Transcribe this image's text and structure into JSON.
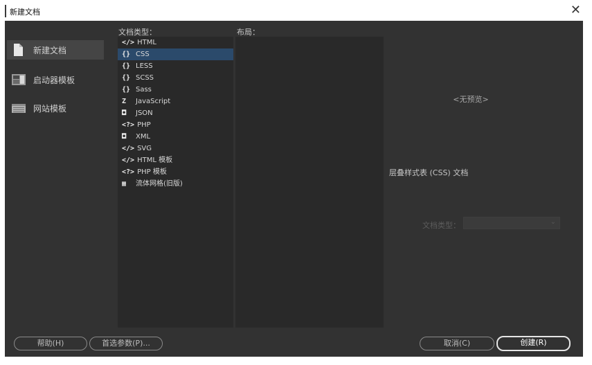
{
  "window": {
    "title": "新建文档",
    "close_glyph": "✕"
  },
  "categories": [
    {
      "label": "新建文档",
      "icon": "new-document-icon"
    },
    {
      "label": "启动器模板",
      "icon": "starter-templates-icon"
    },
    {
      "label": "网站模板",
      "icon": "site-templates-icon"
    }
  ],
  "headers": {
    "doc_type": "文档类型：",
    "layout": "布局："
  },
  "doc_types": [
    {
      "glyph": "</>",
      "label": "HTML"
    },
    {
      "glyph": "{}",
      "label": "CSS"
    },
    {
      "glyph": "{}",
      "label": "LESS"
    },
    {
      "glyph": "{}",
      "label": "SCSS"
    },
    {
      "glyph": "{}",
      "label": "Sass"
    },
    {
      "glyph": "Z",
      "label": "JavaScript"
    },
    {
      "glyph": "◘",
      "label": "JSON"
    },
    {
      "glyph": "<?>",
      "label": "PHP"
    },
    {
      "glyph": "◘",
      "label": "XML"
    },
    {
      "glyph": "</>",
      "label": "SVG"
    },
    {
      "glyph": "</>",
      "label": "HTML 模板"
    },
    {
      "glyph": "<?>",
      "label": "PHP 模板"
    },
    {
      "glyph": "▦",
      "label": "流体网格(旧版)"
    }
  ],
  "selected_doc_type": "CSS",
  "preview": {
    "text": "<无预览>",
    "description": "层叠样式表 (CSS) 文档"
  },
  "doctype_field": {
    "label": "文档类型：",
    "value": ""
  },
  "buttons": {
    "help": "帮助(H)",
    "prefs": "首选参数(P)...",
    "cancel": "取消(C)",
    "create": "创建(R)"
  },
  "colors": {
    "dialog_bg": "#323232",
    "list_bg": "#292929",
    "selection": "#2b4a6b",
    "category_selected": "#454545"
  }
}
